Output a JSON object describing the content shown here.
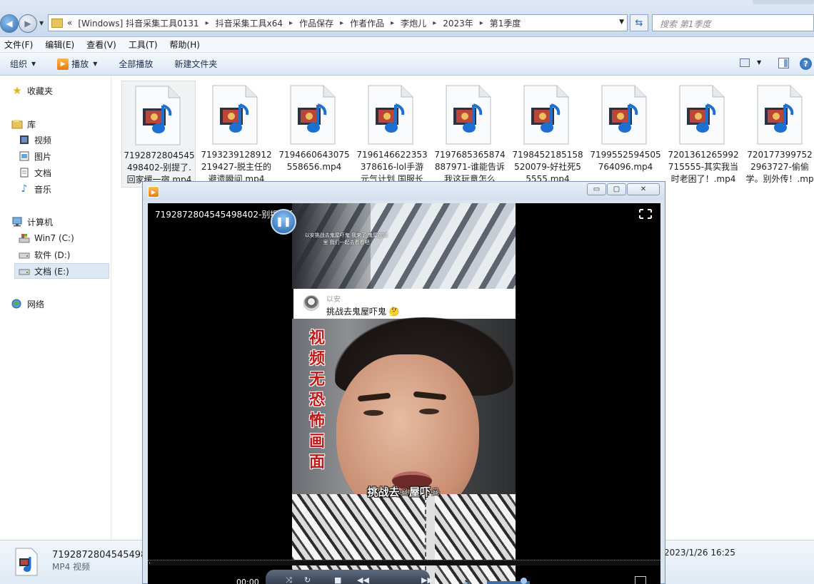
{
  "explorer": {
    "address": {
      "history_glyph": "«",
      "crumbs": [
        "[Windows] 抖音采集工具0131",
        "抖音采集工具x64",
        "作品保存",
        "作者作品",
        "李炮儿",
        "2023年",
        "第1季度"
      ]
    },
    "search": {
      "placeholder": "搜索 第1季度"
    },
    "menu": [
      "文件(F)",
      "编辑(E)",
      "查看(V)",
      "工具(T)",
      "帮助(H)"
    ],
    "toolbar": {
      "organize": "组织",
      "play": "播放",
      "play_all": "全部播放",
      "new_folder": "新建文件夹"
    },
    "nav": {
      "favorites": "收藏夹",
      "libraries": "库",
      "videos": "视频",
      "pictures": "图片",
      "documents": "文档",
      "music": "音乐",
      "computer": "计算机",
      "drive_c": "Win7 (C:)",
      "drive_d": "软件 (D:)",
      "drive_e": "文档 (E:)",
      "network": "网络"
    },
    "files": [
      {
        "name": "7192872804545498402-别提了.回家缓一宿.mp4"
      },
      {
        "name": "7193239128912219427-脱主任的避遗瞬间.mp4"
      },
      {
        "name": "7194660643075558656.mp4"
      },
      {
        "name": "7196146622353378616-lol手游元气计划 国服长"
      },
      {
        "name": "7197685365874887971-谁能告诉我这玩意怎么"
      },
      {
        "name": "7198452185158520079-好社死55555.mp4"
      },
      {
        "name": "7199552594505764096.mp4"
      },
      {
        "name": "7201361265992715555-其实我当时老困了！.mp4"
      },
      {
        "name": "7201773997522963727-偷偷学。别外传！.mp4"
      }
    ],
    "details": {
      "name": "7192872804545498402-别提了.回家缓一宿.mp4",
      "type": "MP4 视频",
      "date": "2023/1/26 16:25"
    }
  },
  "player": {
    "title": "7192872804545498402-别提了.回家缓一宿",
    "time": "00:00",
    "window_buttons": {
      "minimize": "▭",
      "maximize": "▢",
      "close": "✕"
    },
    "video": {
      "comment_user": "以安",
      "comment_text": "挑战去鬼屋吓鬼 🤔",
      "vertical_caption": "视频无恐怖画面",
      "subtitle": "挑战去☠屋吓☠",
      "top_overlay_text": "以安挑战去鬼屋吓鬼 我来了 鬼屋在哪里 我们一起去看看吧"
    }
  },
  "colors": {
    "accent_blue": "#2f6fb7",
    "play_orange": "#e77b0c",
    "caption_red": "#c01a1a"
  }
}
